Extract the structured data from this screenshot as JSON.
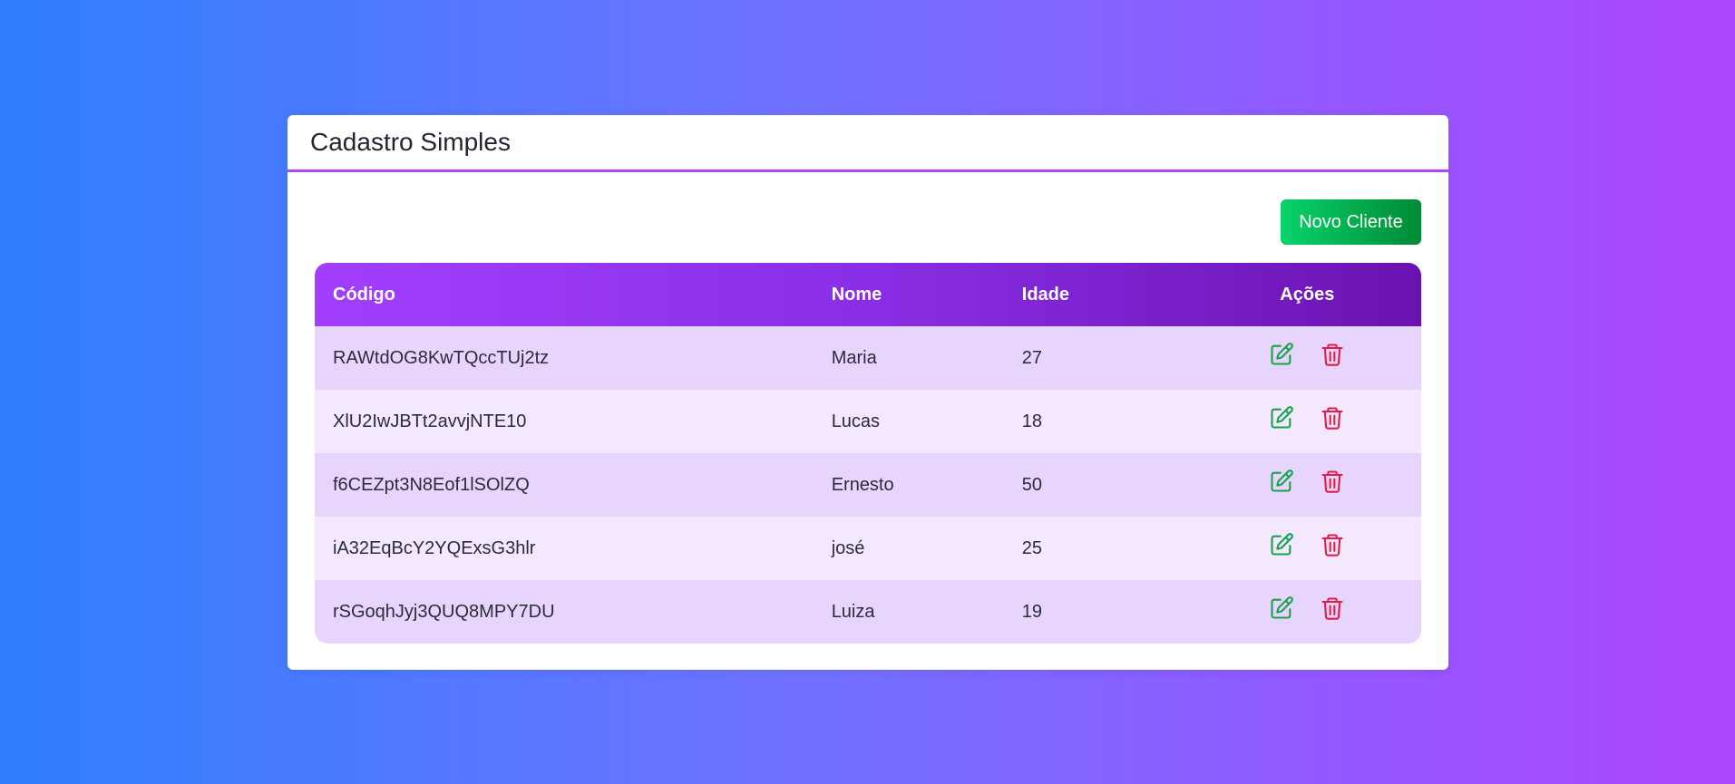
{
  "header": {
    "title": "Cadastro Simples"
  },
  "toolbar": {
    "new_button_label": "Novo Cliente"
  },
  "table": {
    "columns": [
      "Código",
      "Nome",
      "Idade",
      "Ações"
    ],
    "rows": [
      {
        "codigo": "RAWtdOG8KwTQccTUj2tz",
        "nome": "Maria",
        "idade": "27"
      },
      {
        "codigo": "XlU2IwJBTt2avvjNTE10",
        "nome": "Lucas",
        "idade": "18"
      },
      {
        "codigo": "f6CEZpt3N8Eof1lSOlZQ",
        "nome": "Ernesto",
        "idade": "50"
      },
      {
        "codigo": "iA32EqBcY2YQExsG3hlr",
        "nome": "josé",
        "idade": "25"
      },
      {
        "codigo": "rSGoqhJyj3QUQ8MPY7DU",
        "nome": "Luiza",
        "idade": "19"
      }
    ],
    "row_actions": {
      "edit_icon": "edit-icon",
      "delete_icon": "trash-icon"
    }
  },
  "colors": {
    "accent": "#b046f2",
    "edit": "#16a34a",
    "delete": "#e11d48",
    "new_button": "#08d36a"
  }
}
